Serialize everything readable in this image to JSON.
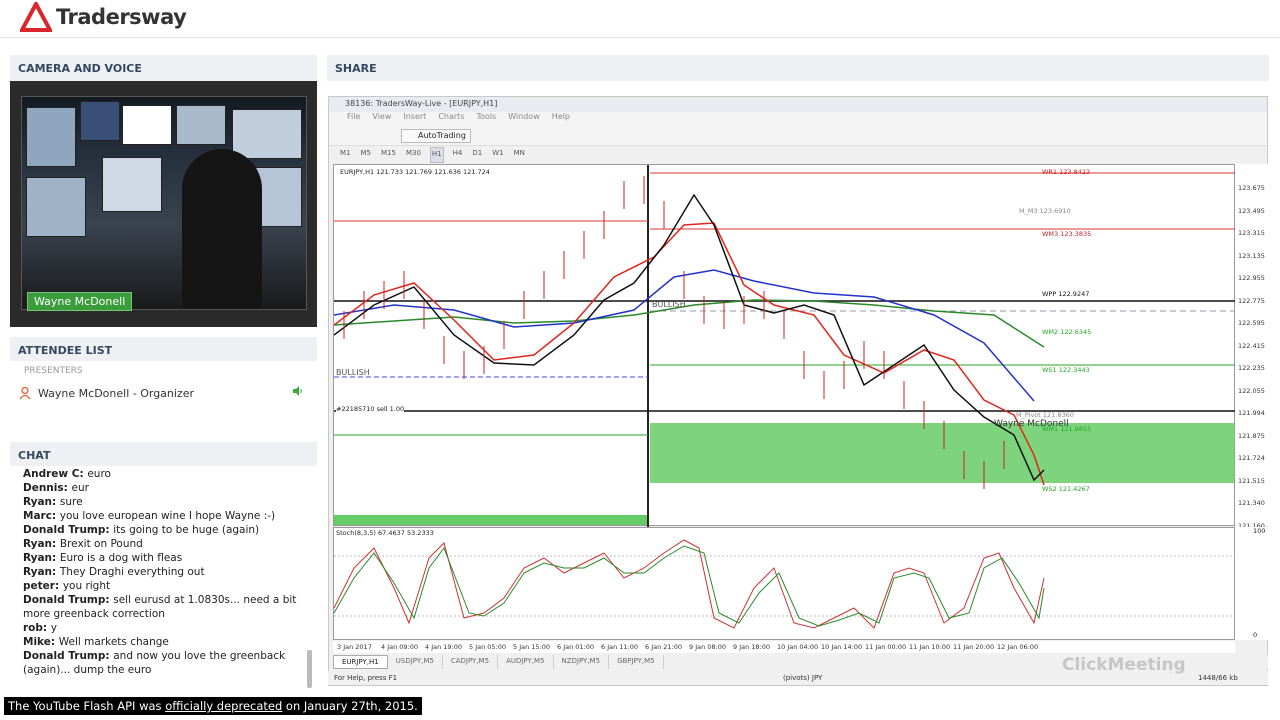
{
  "brand": {
    "name": "Tradersway"
  },
  "camera": {
    "title": "CAMERA AND VOICE",
    "speaker_name": "Wayne McDonell"
  },
  "attendees": {
    "title": "ATTENDEE LIST",
    "section": "PRESENTERS",
    "items": [
      {
        "label": "Wayne McDonell - Organizer"
      }
    ]
  },
  "chat": {
    "title": "CHAT",
    "messages": [
      {
        "author": "Andrew C:",
        "text": "euro"
      },
      {
        "author": "Dennis:",
        "text": "eur"
      },
      {
        "author": "Ryan:",
        "text": "sure"
      },
      {
        "author": "Marc:",
        "text": "you love european wine I hope Wayne :-)"
      },
      {
        "author": "Donald Trump:",
        "text": "its going to be huge (again)"
      },
      {
        "author": "Ryan:",
        "text": "Brexit on Pound"
      },
      {
        "author": "Ryan:",
        "text": "Euro is a dog with fleas"
      },
      {
        "author": "Ryan:",
        "text": "They Draghi everything out"
      },
      {
        "author": "peter:",
        "text": "you right"
      },
      {
        "author": "Donald Trump:",
        "text": "sell eurusd at 1.0830s... need a bit more greenback correction"
      },
      {
        "author": "rob:",
        "text": "y"
      },
      {
        "author": "Mike:",
        "text": "Well markets change"
      },
      {
        "author": "Donald Trump:",
        "text": "and now you love the greenback (again)... dump the euro"
      }
    ]
  },
  "share": {
    "title": "SHARE"
  },
  "mt4": {
    "window_title": "38136: TradersWay-Live - [EURJPY,H1]",
    "menu": [
      "File",
      "View",
      "Insert",
      "Charts",
      "Tools",
      "Window",
      "Help"
    ],
    "autotrading_label": "AutoTrading",
    "timeframes": [
      "M1",
      "M5",
      "M15",
      "M30",
      "H1",
      "H4",
      "D1",
      "W1",
      "MN"
    ],
    "selected_timeframe": "H1",
    "chart_header": "EURJPY,H1  121.733 121.769 121.636 121.724",
    "order_label": "#22185710 sell 1.00",
    "bullish_left": "BULLISH",
    "bullish_mid": "BULLISH",
    "annotation_name": "Wayne McDonell",
    "pivots": [
      {
        "label": "WR1 123.8423"
      },
      {
        "label": "M_M3 123.6910"
      },
      {
        "label": "WM3 123.3835"
      },
      {
        "label": "WPP 122.9247"
      },
      {
        "label": "WM2 122.6345"
      },
      {
        "label": "WS1 122.3443"
      },
      {
        "label": "M_Pivot 121.8360"
      },
      {
        "label": "WM1 121.8855"
      },
      {
        "label": "WS2 121.4267"
      }
    ],
    "price_ticks": [
      "123.675",
      "123.495",
      "123.315",
      "123.135",
      "122.955",
      "122.775",
      "122.595",
      "122.415",
      "122.235",
      "122.055",
      "121.994",
      "121.875",
      "121.724",
      "121.515",
      "121.340",
      "121.160"
    ],
    "osc_label": "Stoch(8,3,5) 67.4637 53.2333",
    "osc_ticks": [
      "100",
      "0"
    ],
    "time_ticks": [
      "3 Jan 2017",
      "4 Jan 09:00",
      "4 Jan 19:00",
      "5 Jan 05:00",
      "5 Jan 15:00",
      "6 Jan 01:00",
      "6 Jan 11:00",
      "6 Jan 21:00",
      "9 Jan 08:00",
      "9 Jan 18:00",
      "10 Jan 04:00",
      "10 Jan 14:00",
      "11 Jan 00:00",
      "11 Jan 10:00",
      "11 Jan 20:00",
      "12 Jan 06:00"
    ],
    "symbol_tabs": [
      "EURJPY,H1",
      "USDJPY,M5",
      "CADJPY,M5",
      "AUDJPY,M5",
      "NZDJPY,M5",
      "GBPJPY,M5"
    ],
    "status_help": "For Help, press F1",
    "status_profile": "(pivots) JPY",
    "status_traffic": "1448/66 kb"
  },
  "watermark": "ClickMeeting",
  "youtube_notice": {
    "prefix": "The YouTube Flash API was ",
    "link": "officially deprecated",
    "suffix": " on January 27th, 2015."
  },
  "colors": {
    "accent_red": "#d9262c",
    "camera_name_bg": "#3a9c3a",
    "zone_green": "#66cc66",
    "ma_red": "#e0261c",
    "ma_blue": "#2233cc",
    "ma_green": "#2a8a2a"
  }
}
